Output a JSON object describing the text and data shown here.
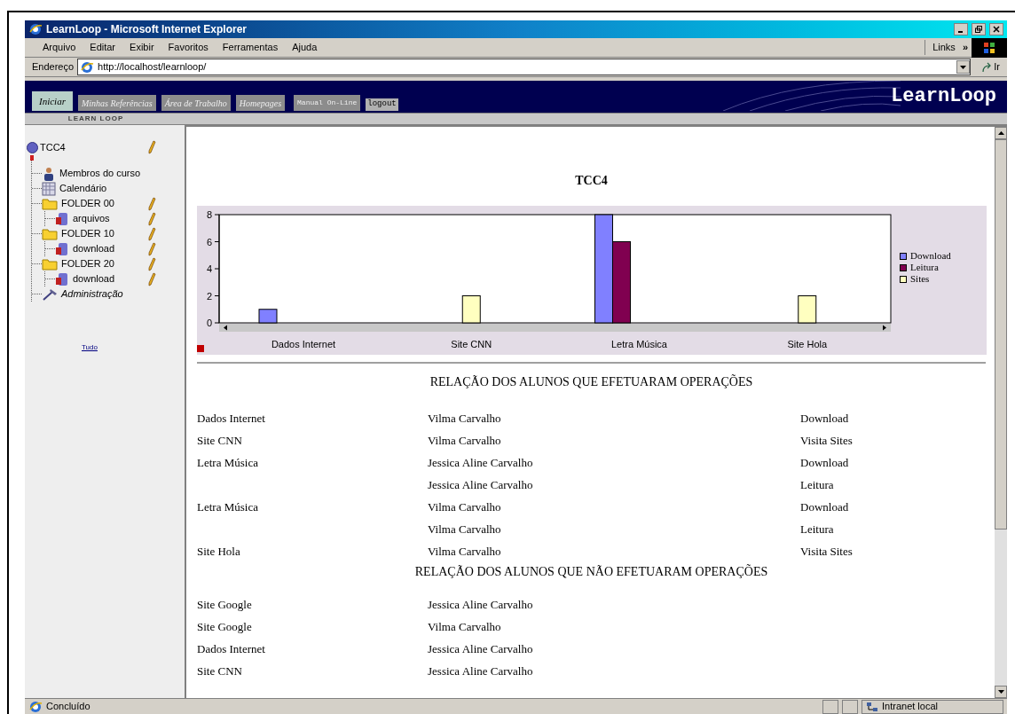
{
  "window": {
    "title": "LearnLoop - Microsoft Internet Explorer"
  },
  "menu": [
    "Arquivo",
    "Editar",
    "Exibir",
    "Favoritos",
    "Ferramentas",
    "Ajuda"
  ],
  "links_label": "Links",
  "links_chevron": "»",
  "address": {
    "label": "Endereço",
    "value": "http://localhost/learnloop/",
    "go": "Ir"
  },
  "app_tabs": [
    {
      "label": "Iniciar",
      "selected": true,
      "kind": "tab"
    },
    {
      "label": "Minhas Referências",
      "selected": false,
      "kind": "tab"
    },
    {
      "label": "Área de Trabalho",
      "selected": false,
      "kind": "tab"
    },
    {
      "label": "Homepages",
      "selected": false,
      "kind": "tab"
    },
    {
      "label": "Manual On-Line",
      "selected": false,
      "kind": "small"
    },
    {
      "label": "logout",
      "selected": false,
      "kind": "logout"
    }
  ],
  "brand": "LearnLoop",
  "sidebar": {
    "title": "LEARN LOOP",
    "tree": {
      "label": "TCC4",
      "editable": true,
      "children": [
        {
          "label": "Membros do curso",
          "kind": "members",
          "editable": false
        },
        {
          "label": "Calendário",
          "kind": "calendar",
          "editable": false
        },
        {
          "label": "FOLDER 00",
          "kind": "folder",
          "editable": true,
          "children": [
            {
              "label": "arquivos",
              "kind": "file",
              "editable": true
            }
          ]
        },
        {
          "label": "FOLDER 10",
          "kind": "folder",
          "editable": true,
          "children": [
            {
              "label": "download",
              "kind": "file",
              "editable": true
            }
          ]
        },
        {
          "label": "FOLDER 20",
          "kind": "folder",
          "editable": true,
          "children": [
            {
              "label": "download",
              "kind": "file",
              "editable": true
            }
          ]
        },
        {
          "label": "Administração",
          "kind": "admin",
          "editable": false
        }
      ]
    },
    "all_link": "Tudo"
  },
  "report": {
    "title": "TCC4",
    "chart_data": {
      "type": "bar",
      "legend": "right",
      "categories": [
        "Dados Internet",
        "Site CNN",
        "Letra Música",
        "Site Hola"
      ],
      "yticks": [
        0,
        2,
        4,
        6,
        8
      ],
      "ylim": [
        0,
        8
      ],
      "series": [
        {
          "name": "Download",
          "color": "#8080ff",
          "values": [
            1,
            null,
            8,
            null
          ]
        },
        {
          "name": "Leitura",
          "color": "#800050",
          "values": [
            null,
            null,
            6,
            null
          ]
        },
        {
          "name": "Sites",
          "color": "#ffffc0",
          "values": [
            null,
            2,
            null,
            2
          ]
        }
      ]
    },
    "sections": [
      {
        "heading": "RELAÇÃO DOS ALUNOS QUE EFETUARAM OPERAÇÕES",
        "rows": [
          {
            "column_1": "Dados Internet",
            "column_2": "Vilma Carvalho",
            "column_3": "Download"
          },
          {
            "column_1": "Site CNN",
            "column_2": "Vilma Carvalho",
            "column_3": "Visita Sites"
          },
          {
            "column_1": "Letra Música",
            "column_2": "Jessica Aline Carvalho",
            "column_3": "Download"
          },
          {
            "column_2": "Jessica Aline Carvalho",
            "column_3": "Leitura"
          },
          {
            "column_1": "Letra Música",
            "column_2": "Vilma Carvalho",
            "column_3": "Download"
          },
          {
            "column_2": "Vilma Carvalho",
            "column_3": "Leitura"
          },
          {
            "column_1": "Site Hola",
            "column_2": "Vilma Carvalho",
            "column_3": "Visita Sites"
          }
        ]
      },
      {
        "heading": "RELAÇÃO DOS ALUNOS QUE NÃO EFETUARAM OPERAÇÕES",
        "rows": [
          {
            "column_1": "Site Google",
            "column_2": "Jessica Aline Carvalho"
          },
          {
            "column_1": "Site Google",
            "column_2": "Vilma Carvalho"
          },
          {
            "column_1": "Dados Internet",
            "column_2": "Jessica Aline Carvalho"
          },
          {
            "column_1": "Site CNN",
            "column_2": "Jessica Aline Carvalho"
          }
        ]
      }
    ]
  },
  "status_bar": {
    "text": "Concluído",
    "zone": "Intranet local"
  }
}
